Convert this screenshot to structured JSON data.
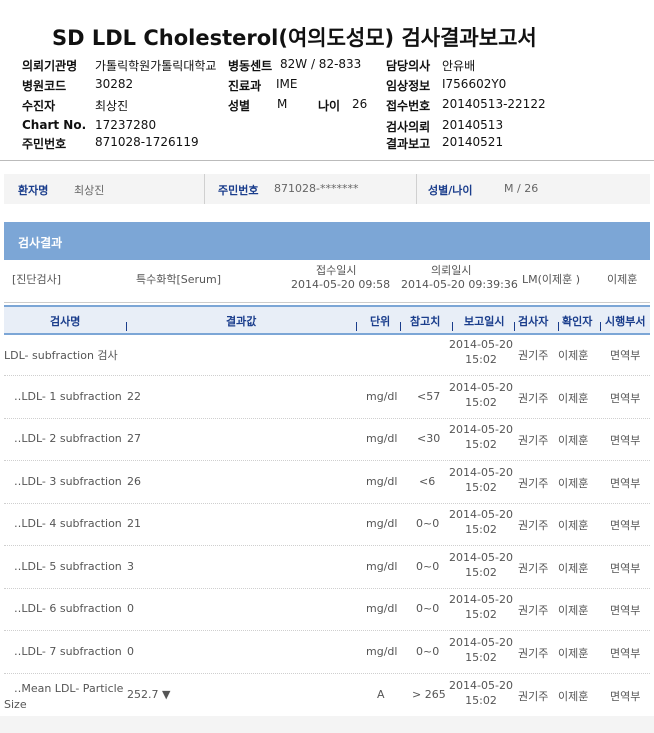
{
  "report": {
    "title": "SD LDL Cholesterol(여의도성모) 검사결과보고서",
    "header": {
      "institution_label": "의뢰기관명",
      "institution_value": "가톨릭학원가톨릭대학교",
      "ward_label": "병동센트",
      "ward_value": "82W / 82-833",
      "hospital_code_label": "병원코드",
      "hospital_code_value": "30282",
      "department_label": "진료과",
      "department_value": "IME",
      "patient_label": "수진자",
      "patient_value": "최상진",
      "sex_label": "성별",
      "sex_value": "M",
      "age_label": "나이",
      "age_value": "26",
      "chart_label": "Chart No.",
      "chart_value": "17237280",
      "resident_label": "주민번호",
      "resident_value": "871028-1726119",
      "doctor_label": "담당의사",
      "doctor_value": "안유배",
      "clinical_label": "임상정보",
      "clinical_value": "I756602Y0",
      "reception_label": "접수번호",
      "reception_value": "20140513-22122",
      "request_label": "검사의뢰",
      "request_value": "20140513",
      "report_label": "결과보고",
      "report_value": "20140521"
    }
  },
  "patient_bar": {
    "name_label": "환자명",
    "name_value": "최상진",
    "id_label": "주민번호",
    "id_value": "871028-*******",
    "sexage_label": "성별/나이",
    "sexage_value": "M / 26"
  },
  "results": {
    "section_title": "검사결과",
    "diag_label": "[진단검사]",
    "category": "특수화학[Serum]",
    "received_label": "접수일시",
    "received_value": "2014-05-20 09:58",
    "requested_label": "의뢰일시",
    "requested_value": "2014-05-20 09:39:36",
    "lm_value": "LM(이제훈 )",
    "lm_person": "이제훈",
    "columns": {
      "test_name": "검사명",
      "result": "결과값",
      "unit": "단위",
      "reference": "참고치",
      "report_date": "보고일시",
      "tester": "검사자",
      "verifier": "확인자",
      "dept": "시행부서"
    },
    "rows": [
      {
        "name": "LDL- subfraction 검사",
        "value": "",
        "unit": "",
        "ref": "",
        "date": "2014-05-20 15:02",
        "tester": "권기주",
        "verifier": "이제훈",
        "dept": "면역부"
      },
      {
        "name": "‥LDL- 1 subfraction",
        "value": "22",
        "unit": "mg/dl",
        "ref": "<57",
        "date": "2014-05-20 15:02",
        "tester": "권기주",
        "verifier": "이제훈",
        "dept": "면역부"
      },
      {
        "name": "‥LDL- 2 subfraction",
        "value": "27",
        "unit": "mg/dl",
        "ref": "<30",
        "date": "2014-05-20 15:02",
        "tester": "권기주",
        "verifier": "이제훈",
        "dept": "면역부"
      },
      {
        "name": "‥LDL- 3 subfraction",
        "value": "26",
        "unit": "mg/dl",
        "ref": "<6",
        "date": "2014-05-20 15:02",
        "tester": "권기주",
        "verifier": "이제훈",
        "dept": "면역부"
      },
      {
        "name": "‥LDL- 4 subfraction",
        "value": "21",
        "unit": "mg/dl",
        "ref": "0~0",
        "date": "2014-05-20 15:02",
        "tester": "권기주",
        "verifier": "이제훈",
        "dept": "면역부"
      },
      {
        "name": "‥LDL- 5 subfraction",
        "value": "3",
        "unit": "mg/dl",
        "ref": "0~0",
        "date": "2014-05-20 15:02",
        "tester": "권기주",
        "verifier": "이제훈",
        "dept": "면역부"
      },
      {
        "name": "‥LDL- 6 subfraction",
        "value": "0",
        "unit": "mg/dl",
        "ref": "0~0",
        "date": "2014-05-20 15:02",
        "tester": "권기주",
        "verifier": "이제훈",
        "dept": "면역부"
      },
      {
        "name": "‥LDL- 7 subfraction",
        "value": "0",
        "unit": "mg/dl",
        "ref": "0~0",
        "date": "2014-05-20 15:02",
        "tester": "권기주",
        "verifier": "이제훈",
        "dept": "면역부"
      },
      {
        "name": "‥Mean LDL- Particle",
        "name2": "Size",
        "value": "252.7 ▼",
        "unit": "A",
        "ref": "> 265",
        "date": "2014-05-20 15:02",
        "tester": "권기주",
        "verifier": "이제훈",
        "dept": "면역부"
      }
    ]
  }
}
